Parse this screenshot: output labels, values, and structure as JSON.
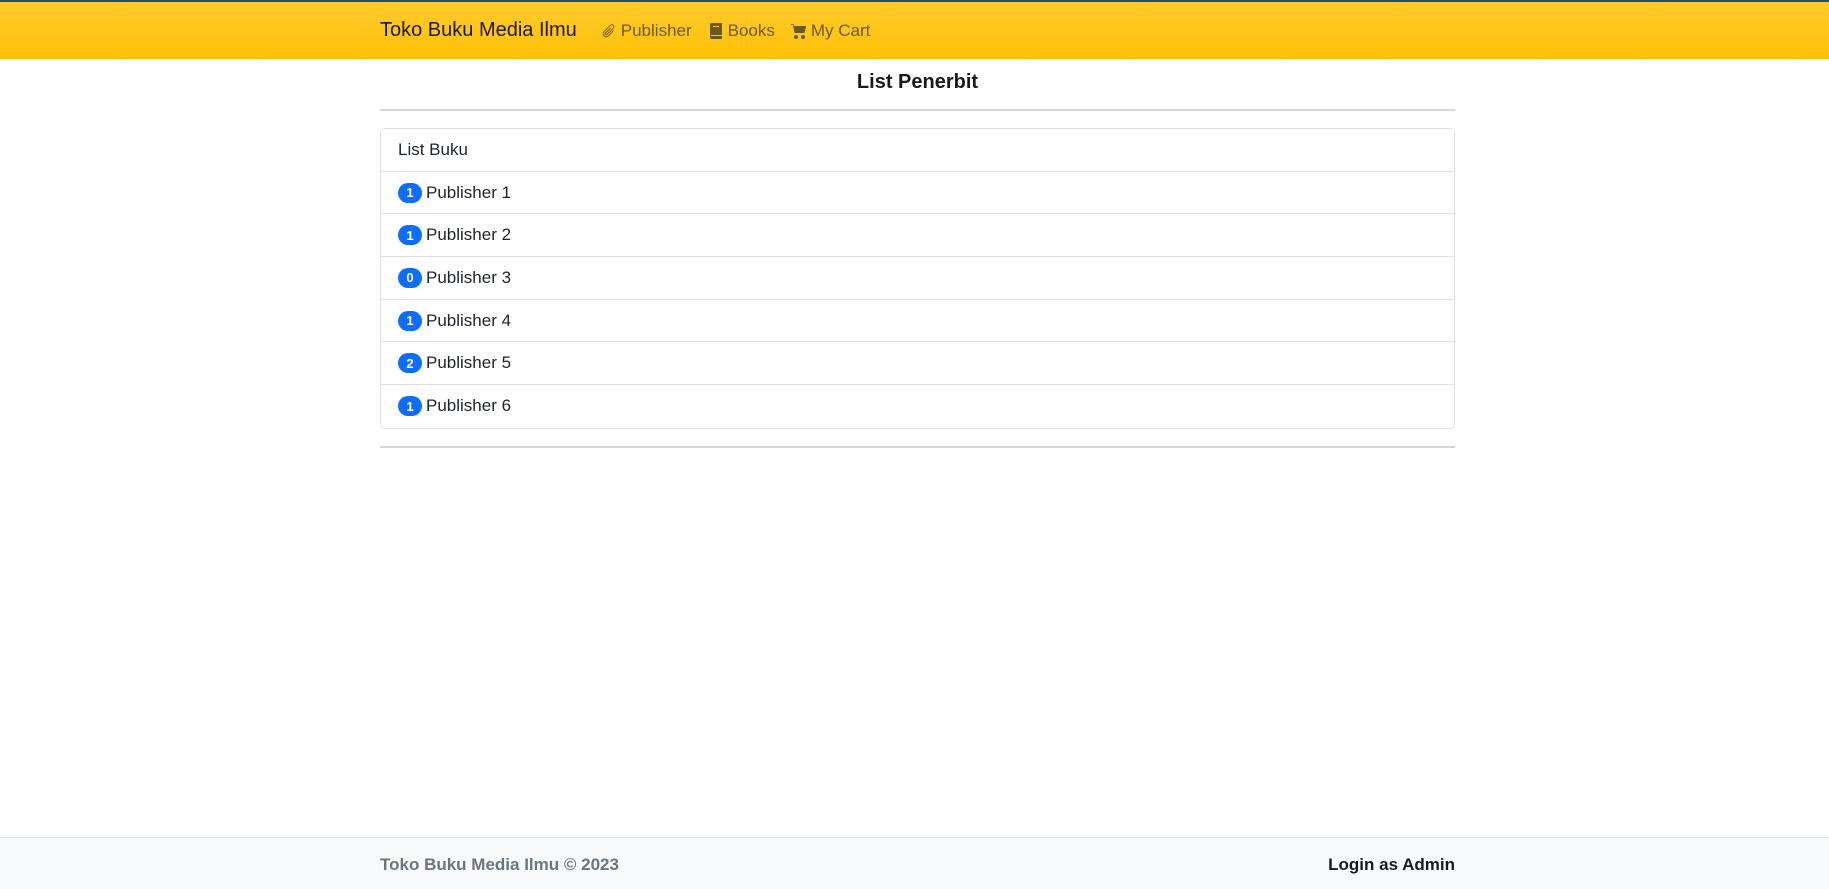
{
  "navbar": {
    "brand": "Toko Buku Media Ilmu",
    "links": [
      {
        "label": "Publisher",
        "icon": "paperclip-icon"
      },
      {
        "label": "Books",
        "icon": "book-icon"
      },
      {
        "label": "My Cart",
        "icon": "cart-icon"
      }
    ]
  },
  "main": {
    "title": "List Penerbit",
    "list_header": "List Buku",
    "publishers": [
      {
        "count": "1",
        "name": "Publisher 1"
      },
      {
        "count": "1",
        "name": "Publisher 2"
      },
      {
        "count": "0",
        "name": "Publisher 3"
      },
      {
        "count": "1",
        "name": "Publisher 4"
      },
      {
        "count": "2",
        "name": "Publisher 5"
      },
      {
        "count": "1",
        "name": "Publisher 6"
      }
    ]
  },
  "footer": {
    "copyright": "Toko Buku Media Ilmu © 2023",
    "login_status": "Login as Admin"
  },
  "colors": {
    "navbar": "#ffc107",
    "badge": "#0d6efd",
    "footer": "#f8f9fa"
  }
}
